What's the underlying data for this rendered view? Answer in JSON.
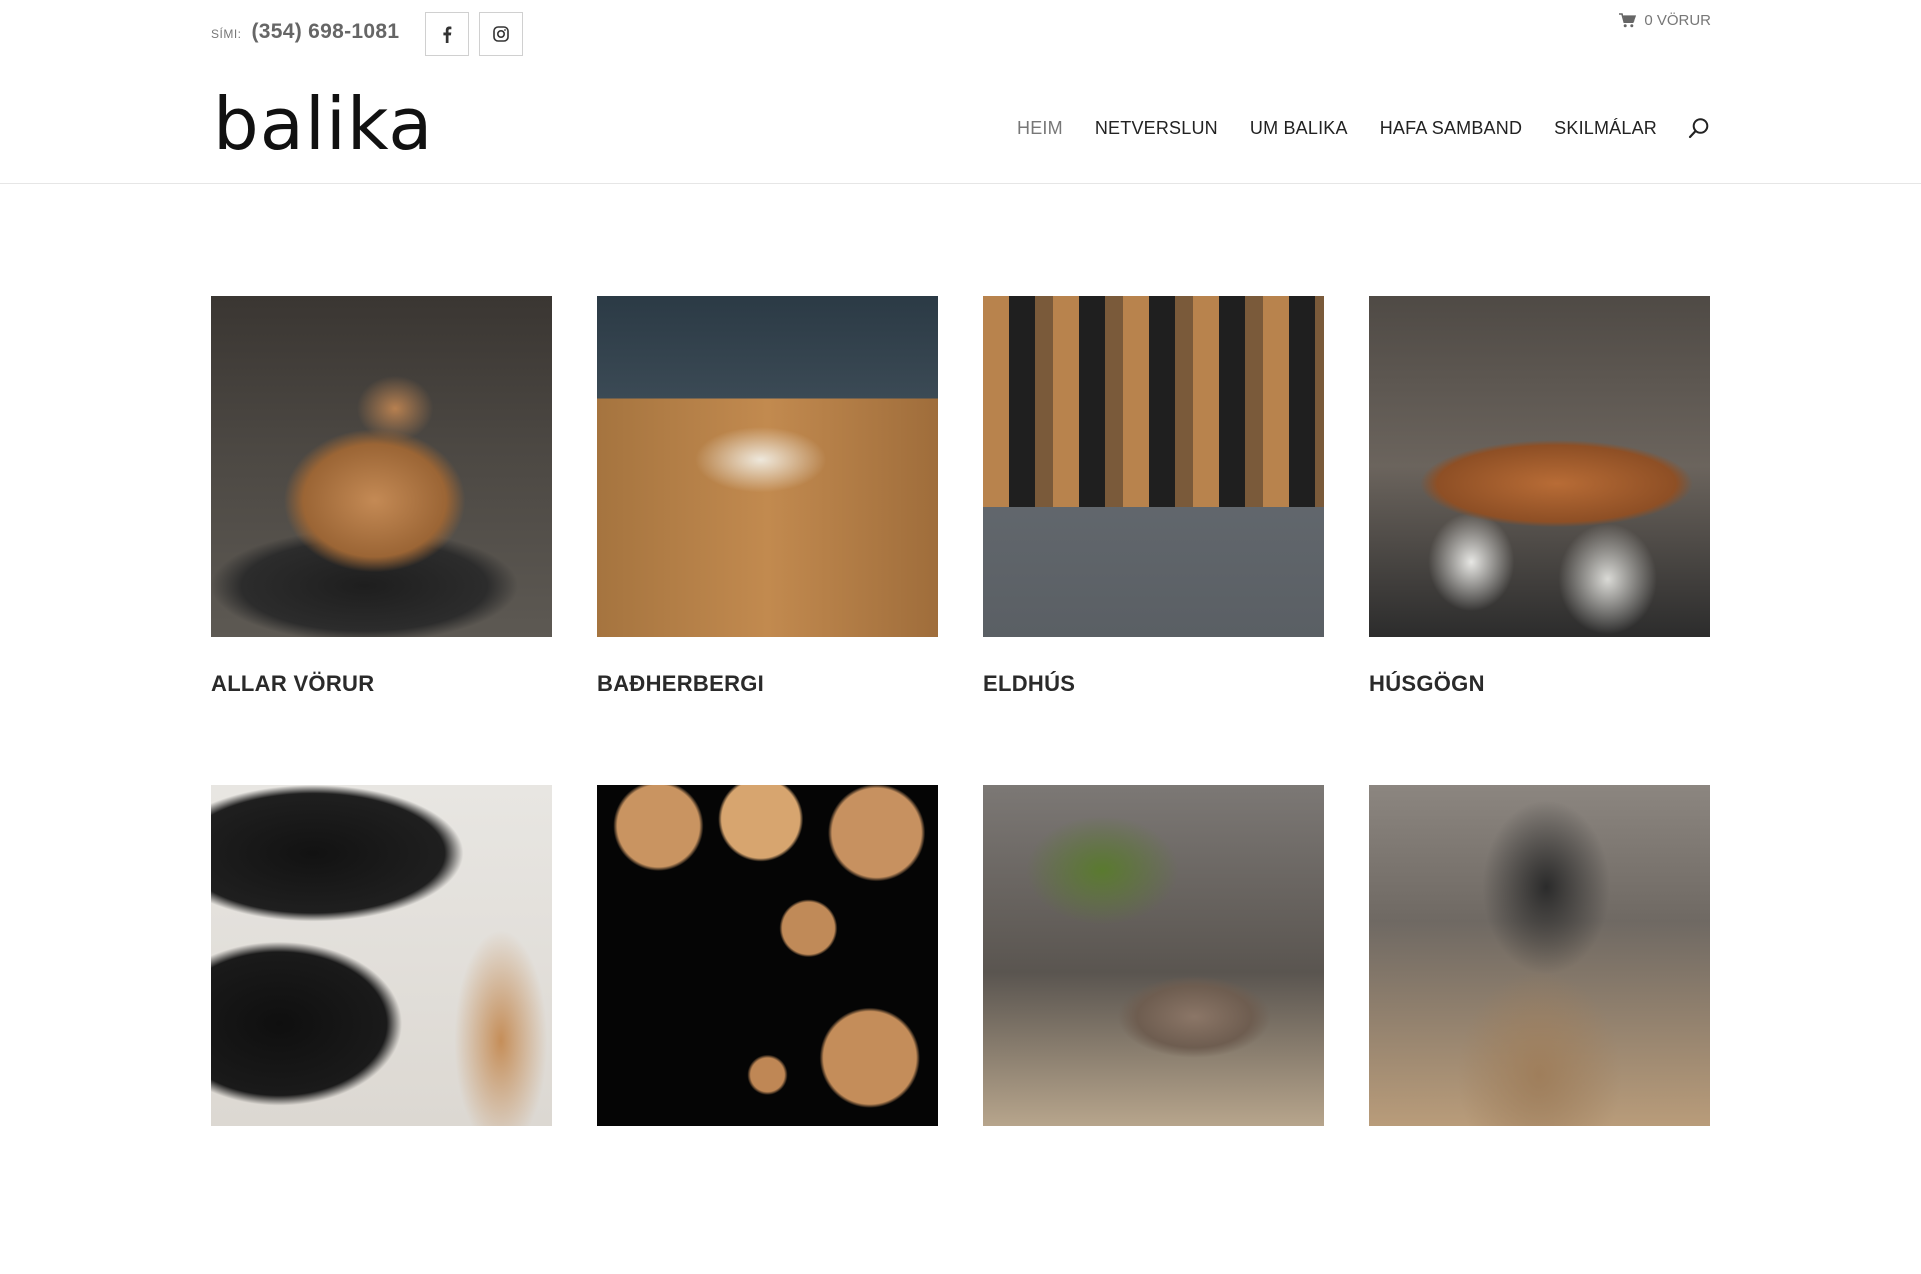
{
  "topbar": {
    "phone_label": "SÍMI:",
    "phone_number": "(354) 698-1081",
    "social": [
      {
        "icon": "facebook-icon"
      },
      {
        "icon": "instagram-icon"
      }
    ],
    "cart_label": "0 VÖRUR"
  },
  "header": {
    "logo": "balika",
    "nav": {
      "home": "HEIM",
      "shop": "NETVERSLUN",
      "about": "UM BALIKA",
      "contact": "HAFA SAMBAND",
      "terms": "SKILMÁLAR"
    }
  },
  "categories": [
    {
      "title": "ALLAR VÖRUR"
    },
    {
      "title": "BAÐHERBERGI"
    },
    {
      "title": "ELDHÚS"
    },
    {
      "title": "HÚSGÖGN"
    },
    {
      "title": ""
    },
    {
      "title": ""
    },
    {
      "title": ""
    },
    {
      "title": ""
    }
  ],
  "colors": {
    "text_dark": "#222222",
    "text_muted": "#777777",
    "border": "#e6e6e6"
  }
}
